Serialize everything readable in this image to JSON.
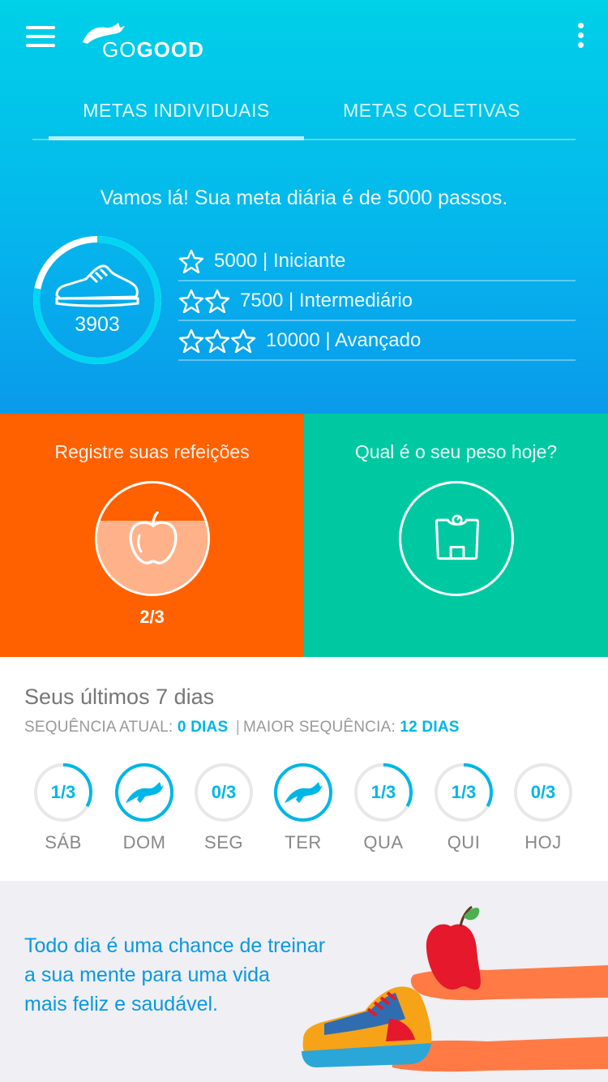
{
  "app": {
    "logo_prefix": "GO",
    "logo_suffix": "GOOD"
  },
  "tabs": [
    {
      "label": "METAS INDIVIDUAIS",
      "active": true
    },
    {
      "label": "METAS COLETIVAS",
      "active": false
    }
  ],
  "goal": {
    "message": "Vamos lá! Sua meta diária é de 5000 passos.",
    "steps": "3903",
    "progress": 0.78,
    "levels": [
      {
        "stars": 1,
        "label": "5000 | Iniciante"
      },
      {
        "stars": 2,
        "label": "7500 | Intermediário"
      },
      {
        "stars": 3,
        "label": "10000 | Avançado"
      }
    ]
  },
  "meals": {
    "title": "Registre suas refeições",
    "count": "2/3",
    "progress": 0.66
  },
  "weight": {
    "title": "Qual é o seu peso hoje?"
  },
  "history": {
    "title": "Seus últimos 7 dias",
    "current_label": "SEQUÊNCIA ATUAL:",
    "current_value": "0 DIAS",
    "separator": "|",
    "best_label": "MAIOR SEQUÊNCIA:",
    "best_value": "12 DIAS",
    "days": [
      {
        "label": "SÁB",
        "value": "1/3",
        "progress": 0.333,
        "complete": false
      },
      {
        "label": "DOM",
        "value": "",
        "progress": 1,
        "complete": true
      },
      {
        "label": "SEG",
        "value": "0/3",
        "progress": 0,
        "complete": false
      },
      {
        "label": "TER",
        "value": "",
        "progress": 1,
        "complete": true
      },
      {
        "label": "QUA",
        "value": "1/3",
        "progress": 0.333,
        "complete": false
      },
      {
        "label": "QUI",
        "value": "1/3",
        "progress": 0.333,
        "complete": false
      },
      {
        "label": "HOJ",
        "value": "0/3",
        "progress": 0,
        "complete": false
      }
    ]
  },
  "promo": {
    "line1": "Todo dia é uma chance de treinar",
    "line2": "a sua mente para uma vida",
    "line3": "mais feliz e saudável."
  },
  "colors": {
    "accent": "#00b6e6",
    "meal_tile": "#ff6000",
    "weight_tile": "#00c9a2",
    "promo_text": "#0a98e0"
  }
}
